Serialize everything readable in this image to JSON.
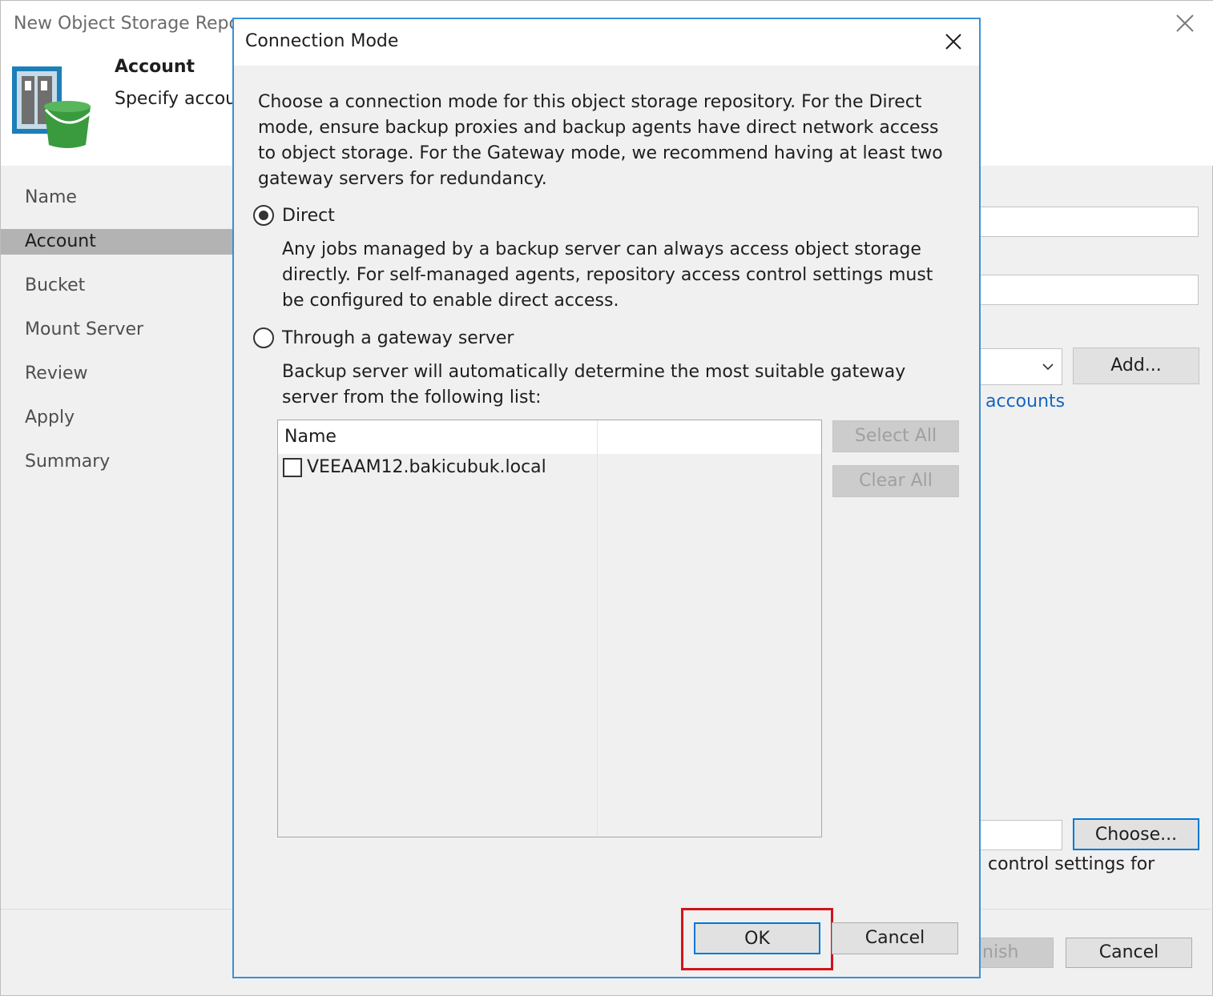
{
  "wizard": {
    "title": "New Object Storage Repo",
    "step_title": "Account",
    "step_subtitle": "Specify accou",
    "nav": [
      "Name",
      "Account",
      "Bucket",
      "Mount Server",
      "Review",
      "Apply",
      "Summary"
    ],
    "active_nav": "Account",
    "add_label": "Add...",
    "accounts_link": "accounts",
    "choose_label": "Choose...",
    "control_text": "control settings for",
    "finish_label": "nish",
    "cancel_label": "Cancel"
  },
  "dialog": {
    "title": "Connection Mode",
    "description": "Choose a connection mode for this object storage repository. For the Direct mode, ensure backup proxies and backup agents have direct network access to object storage. For the Gateway mode, we recommend having at least two gateway servers for redundancy.",
    "direct": {
      "label": "Direct",
      "selected": true,
      "description": "Any jobs managed by a backup server can always access object storage directly. For self-managed agents, repository access control settings must be configured to enable direct access."
    },
    "gateway": {
      "label": "Through a gateway server",
      "selected": false,
      "description": "Backup server will automatically determine the most suitable gateway server from the following list:"
    },
    "list": {
      "column": "Name",
      "rows": [
        {
          "name": "VEEAAM12.bakicubuk.local",
          "checked": false
        }
      ]
    },
    "select_all_label": "Select All",
    "clear_all_label": "Clear All",
    "ok_label": "OK",
    "cancel_label": "Cancel"
  },
  "colors": {
    "accent": "#0078d7",
    "dialog_border": "#3a8fd9",
    "highlight": "#d0141a",
    "link": "#1565c0"
  }
}
